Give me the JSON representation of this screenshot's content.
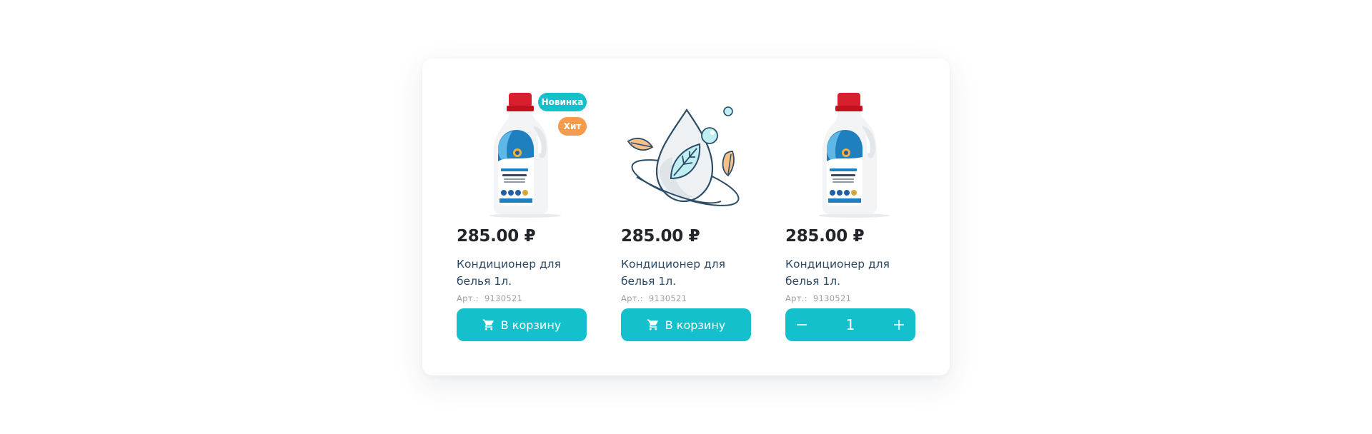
{
  "currency_symbol": "₽",
  "colors": {
    "accent": "#14c0cc",
    "badge_hit": "#f69a4c",
    "price_text": "#222529",
    "title_text": "#2a4a66",
    "sku_text": "#9aa1a8"
  },
  "products": [
    {
      "image": "detergent-bottle",
      "badges": [
        "Новинка",
        "Хит"
      ],
      "price": "285.00 ₽",
      "title": "Кондиционер для белья 1л.",
      "sku_label": "Арт.:",
      "sku_value": "9130521",
      "action": {
        "type": "button",
        "icon": "cart-icon",
        "label": "В корзину"
      }
    },
    {
      "image": "placeholder-leaf-drop",
      "badges": [],
      "price": "285.00 ₽",
      "title": "Кондиционер для белья 1л.",
      "sku_label": "Арт.:",
      "sku_value": "9130521",
      "action": {
        "type": "button",
        "icon": "cart-icon",
        "label": "В корзину"
      }
    },
    {
      "image": "detergent-bottle",
      "badges": [],
      "price": "285.00 ₽",
      "title": "Кондиционер для белья 1л.",
      "sku_label": "Арт.:",
      "sku_value": "9130521",
      "action": {
        "type": "stepper",
        "minus_icon": "minus-icon",
        "plus_icon": "plus-icon",
        "quantity": "1"
      }
    }
  ]
}
